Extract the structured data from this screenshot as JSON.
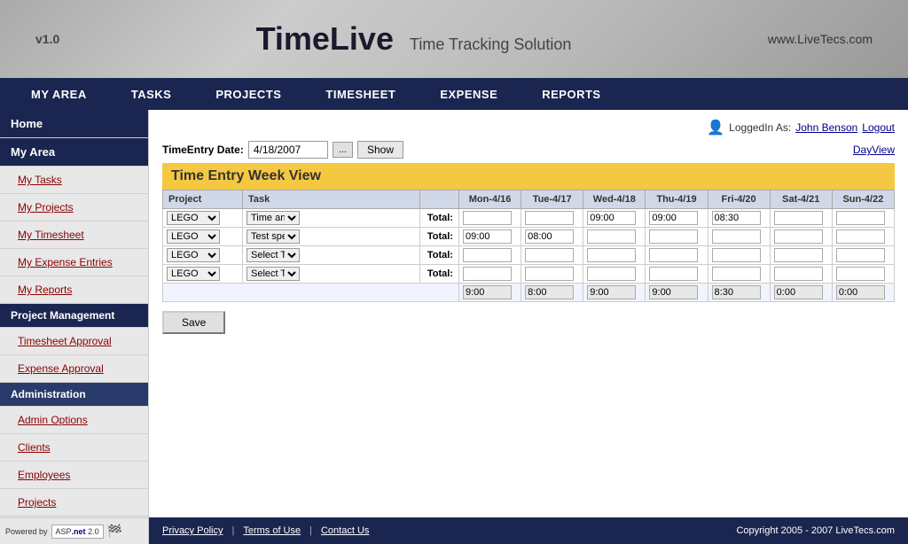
{
  "header": {
    "version": "v1.0",
    "title": "TimeLive",
    "subtitle": "Time Tracking Solution",
    "website": "www.LiveTecs.com"
  },
  "navbar": {
    "items": [
      {
        "label": "MY AREA",
        "id": "my-area"
      },
      {
        "label": "TASKS",
        "id": "tasks"
      },
      {
        "label": "PROJECTS",
        "id": "projects"
      },
      {
        "label": "TIMESHEET",
        "id": "timesheet"
      },
      {
        "label": "EXPENSE",
        "id": "expense"
      },
      {
        "label": "REPORTS",
        "id": "reports"
      }
    ]
  },
  "sidebar": {
    "home_label": "Home",
    "my_area_label": "My Area",
    "my_tasks_label": "My Tasks",
    "my_projects_label": "My Projects",
    "my_timesheet_label": "My Timesheet",
    "my_expense_entries_label": "My Expense Entries",
    "my_reports_label": "My Reports",
    "project_management_label": "Project Management",
    "timesheet_approval_label": "Timesheet Approval",
    "expense_approval_label": "Expense Approval",
    "administration_label": "Administration",
    "admin_options_label": "Admin Options",
    "clients_label": "Clients",
    "employees_label": "Employees",
    "projects_label": "Projects"
  },
  "content": {
    "logged_in_label": "LoggedIn As:",
    "user_name": "John Benson",
    "logout_label": "Logout",
    "date_label": "TimeEntry Date:",
    "date_value": "4/18/2007",
    "cal_btn_label": "...",
    "show_btn_label": "Show",
    "day_view_label": "DayView",
    "time_entry_title": "Time Entry Week View",
    "table_headers": {
      "project": "Project",
      "task": "Task",
      "mon": "Mon-4/16",
      "tue": "Tue-4/17",
      "wed": "Wed-4/18",
      "thu": "Thu-4/19",
      "fri": "Fri-4/20",
      "sat": "Sat-4/21",
      "sun": "Sun-4/22"
    },
    "rows": [
      {
        "project": "LEGO",
        "task": "Time and resource plan",
        "total_label": "Total:",
        "mon": "",
        "tue": "",
        "wed": "09:00",
        "thu": "09:00",
        "fri": "08:30",
        "sat": "",
        "sun": ""
      },
      {
        "project": "LEGO",
        "task": "Test specification and plan",
        "total_label": "Total:",
        "mon": "09:00",
        "tue": "08:00",
        "wed": "",
        "thu": "",
        "fri": "",
        "sat": "",
        "sun": ""
      },
      {
        "project": "LEGO",
        "task": "Select Tasks",
        "total_label": "Total:",
        "mon": "",
        "tue": "",
        "wed": "",
        "thu": "",
        "fri": "",
        "sat": "",
        "sun": ""
      },
      {
        "project": "LEGO",
        "task": "Select Tasks",
        "total_label": "Total:",
        "mon": "",
        "tue": "",
        "wed": "",
        "thu": "",
        "fri": "",
        "sat": "",
        "sun": ""
      }
    ],
    "totals_row": {
      "mon": "9:00",
      "tue": "8:00",
      "wed": "9:00",
      "thu": "9:00",
      "fri": "8:30",
      "sat": "0:00",
      "sun": "0:00"
    },
    "save_label": "Save"
  },
  "footer": {
    "privacy_policy": "Privacy Policy",
    "terms_of_use": "Terms of Use",
    "contact_us": "Contact Us",
    "copyright": "Copyright 2005 - 2007 LiveTecs.com",
    "powered_by": "Powered by",
    "aspnet": "ASP.net 2.0"
  }
}
